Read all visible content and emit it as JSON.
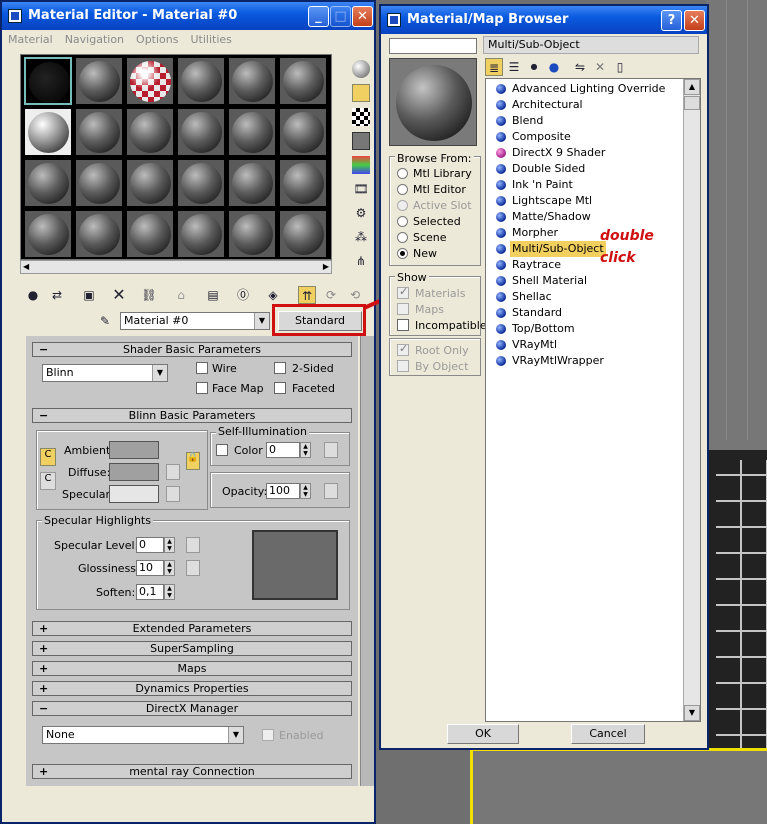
{
  "material_editor": {
    "title": "Material Editor - Material #0",
    "menu": [
      "Material",
      "Navigation",
      "Options",
      "Utilities"
    ],
    "material_name": "Material #0",
    "type_button": "Standard",
    "shader_rollout": {
      "title": "Shader Basic Parameters",
      "shader": "Blinn",
      "wire": "Wire",
      "two_sided": "2-Sided",
      "face_map": "Face Map",
      "faceted": "Faceted"
    },
    "blinn_rollout": {
      "title": "Blinn Basic Parameters",
      "self_illum_title": "Self-Illumination",
      "color_label": "Color",
      "color_value": "0",
      "ambient": "Ambient:",
      "diffuse": "Diffuse:",
      "specular": "Specular:",
      "opacity_label": "Opacity:",
      "opacity_value": "100",
      "spec_highlights_title": "Specular Highlights",
      "spec_level_label": "Specular Level:",
      "spec_level_value": "0",
      "glossiness_label": "Glossiness:",
      "glossiness_value": "10",
      "soften_label": "Soften:",
      "soften_value": "0,1"
    },
    "collapsed_rollouts": [
      "Extended Parameters",
      "SuperSampling",
      "Maps",
      "Dynamics Properties"
    ],
    "directx": {
      "title": "DirectX Manager",
      "dropdown": "None",
      "enabled": "Enabled"
    },
    "mental_ray": "mental ray Connection",
    "rollout_plus": "+",
    "rollout_minus": "−",
    "colors": {
      "ambient": "#a0a0a0",
      "diffuse": "#a0a0a0",
      "specular": "#e6e6e6"
    }
  },
  "browser": {
    "title": "Material/Map Browser",
    "search_value": "",
    "selected_type": "Multi/Sub-Object",
    "browse_from": {
      "title": "Browse From:",
      "options": [
        "Mtl Library",
        "Mtl Editor",
        "Active Slot",
        "Selected",
        "Scene",
        "New"
      ],
      "selected": "New"
    },
    "show": {
      "title": "Show",
      "materials": "Materials",
      "maps": "Maps",
      "incompatible": "Incompatible"
    },
    "root_only": "Root Only",
    "by_object": "By Object",
    "items": [
      "Advanced Lighting Override",
      "Architectural",
      "Blend",
      "Composite",
      "DirectX 9 Shader",
      "Double Sided",
      "Ink 'n Paint",
      "Lightscape Mtl",
      "Matte/Shadow",
      "Morpher",
      "Multi/Sub-Object",
      "Raytrace",
      "Shell Material",
      "Shellac",
      "Standard",
      "Top/Bottom",
      "VRayMtl",
      "VRayMtlWrapper"
    ],
    "ok": "OK",
    "cancel": "Cancel"
  },
  "annotation": {
    "line1": "double",
    "line2": "click",
    "color": "#d01010"
  }
}
